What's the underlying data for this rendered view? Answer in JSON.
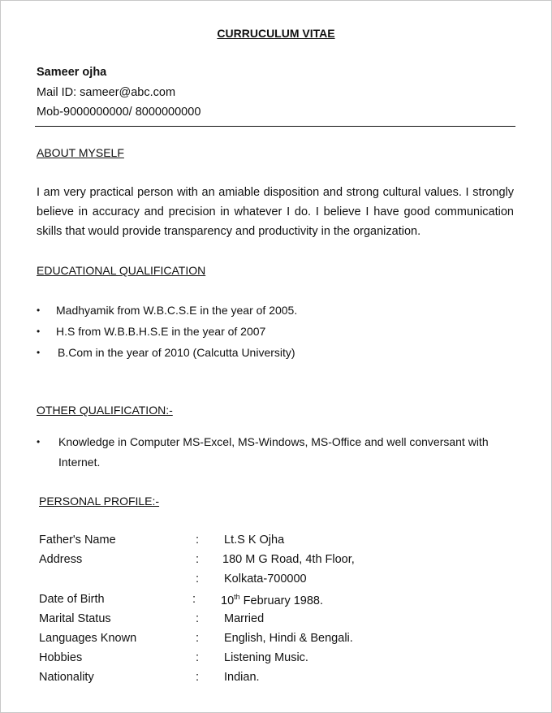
{
  "title": "CURRUCULUM VITAE",
  "header": {
    "name": "Sameer ojha",
    "mail": "Mail ID: sameer@abc.com",
    "mobile": "Mob-9000000000/ 8000000000"
  },
  "about": {
    "heading": "ABOUT MYSELF",
    "text": "I am very practical person with an amiable disposition and strong cultural values. I strongly believe in accuracy and precision in whatever I do. I believe I have good communication skills that would provide transparency and productivity in the organization."
  },
  "education": {
    "heading": "EDUCATIONAL QUALIFICATION",
    "items": [
      "Madhyamik from W.B.C.S.E in the year of 2005.",
      "H.S from W.B.B.H.S.E in the year of 2007",
      "B.Com in the year of 2010 (Calcutta University)"
    ]
  },
  "other": {
    "heading": "OTHER QUALIFICATION:-",
    "line1": "Knowledge in Computer MS-Excel, MS-Windows, MS-Office and well conversant with",
    "line2": "Internet."
  },
  "profile": {
    "heading": "PERSONAL PROFILE:-",
    "colon": ":",
    "rows": [
      {
        "label": "Father's Name",
        "value": "Lt.S K Ojha"
      },
      {
        "label": "Address",
        "value": "180 M G Road, 4th Floor,"
      },
      {
        "label": "",
        "value": "Kolkata-700000"
      },
      {
        "label": "Date of Birth",
        "value_day": "10",
        "value_sup": "th",
        "value_rest": " February 1988."
      },
      {
        "label": "Marital Status",
        "value": "Married"
      },
      {
        "label": "Languages Known",
        "value": "English, Hindi & Bengali."
      },
      {
        "label": "Hobbies",
        "value": "Listening Music."
      },
      {
        "label": "Nationality",
        "value": "Indian."
      }
    ]
  },
  "bullet_glyph": "•"
}
